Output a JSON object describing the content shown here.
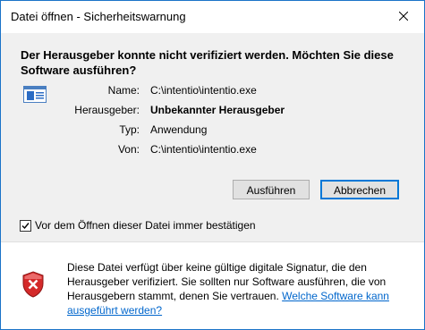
{
  "window": {
    "title": "Datei öffnen - Sicherheitswarnung"
  },
  "dialog": {
    "question": "Der Herausgeber konnte nicht verifiziert werden. Möchten Sie diese Software ausführen?",
    "fields": [
      {
        "label": "Name:",
        "value": "C:\\intentio\\intentio.exe"
      },
      {
        "label": "Herausgeber:",
        "value": "Unbekannter Herausgeber"
      },
      {
        "label": "Typ:",
        "value": "Anwendung"
      },
      {
        "label": "Von:",
        "value": "C:\\intentio\\intentio.exe"
      }
    ],
    "buttons": {
      "run": "Ausführen",
      "cancel": "Abbrechen"
    },
    "checkbox": {
      "label": "Vor dem Öffnen dieser Datei immer bestätigen",
      "checked": true
    }
  },
  "footer": {
    "warning_text": "Diese Datei verfügt über keine gültige digitale Signatur, die den Herausgeber verifiziert. Sie sollten nur Software ausführen, die von Herausgebern stammt, denen Sie vertrauen.",
    "link_text": "Welche Software kann ausgeführt werden?"
  },
  "icons": {
    "app": "application-window-icon",
    "shield": "security-shield-error-icon",
    "close": "close-icon",
    "check": "checkmark-icon"
  },
  "colors": {
    "window_border": "#1a73c8",
    "content_bg": "#f0f0f0",
    "default_button_border": "#0078d7",
    "link": "#0066cc",
    "shield_red": "#d42a2a"
  }
}
